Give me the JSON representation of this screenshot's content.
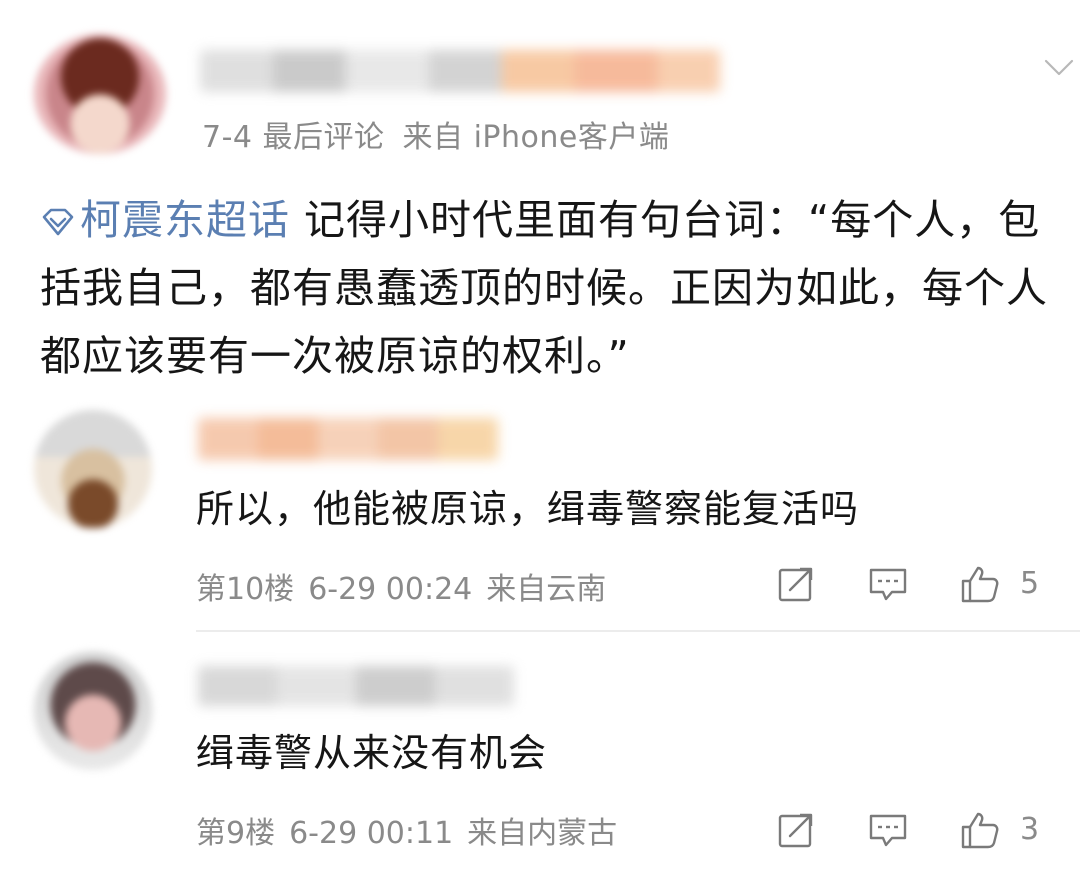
{
  "post": {
    "meta_date": "7-4 最后评论",
    "meta_source": "来自 iPhone客户端",
    "topic_label": "柯震东超话",
    "body_text": " 记得小时代里面有句台词：“每个人，包括我自己，都有愚蠢透顶的时候。正因为如此，每个人都应该要有一次被原谅的权利。”",
    "icons": {
      "collapse": "chevron-down-icon",
      "topic": "super-topic-diamond-icon"
    }
  },
  "replies": [
    {
      "text": "所以，他能被原谅，缉毒警察能复活吗",
      "floor": "第10楼",
      "time": "6-29 00:24",
      "location": "来自云南",
      "like_count": "5"
    },
    {
      "text": "缉毒警从来没有机会",
      "floor": "第9楼",
      "time": "6-29 00:11",
      "location": "来自内蒙古",
      "like_count": "3"
    }
  ],
  "colors": {
    "topic_link": "#5b7fb2",
    "meta_gray": "#8a8a8a",
    "icon_gray": "#7a7a7a",
    "divider": "#ececec"
  }
}
